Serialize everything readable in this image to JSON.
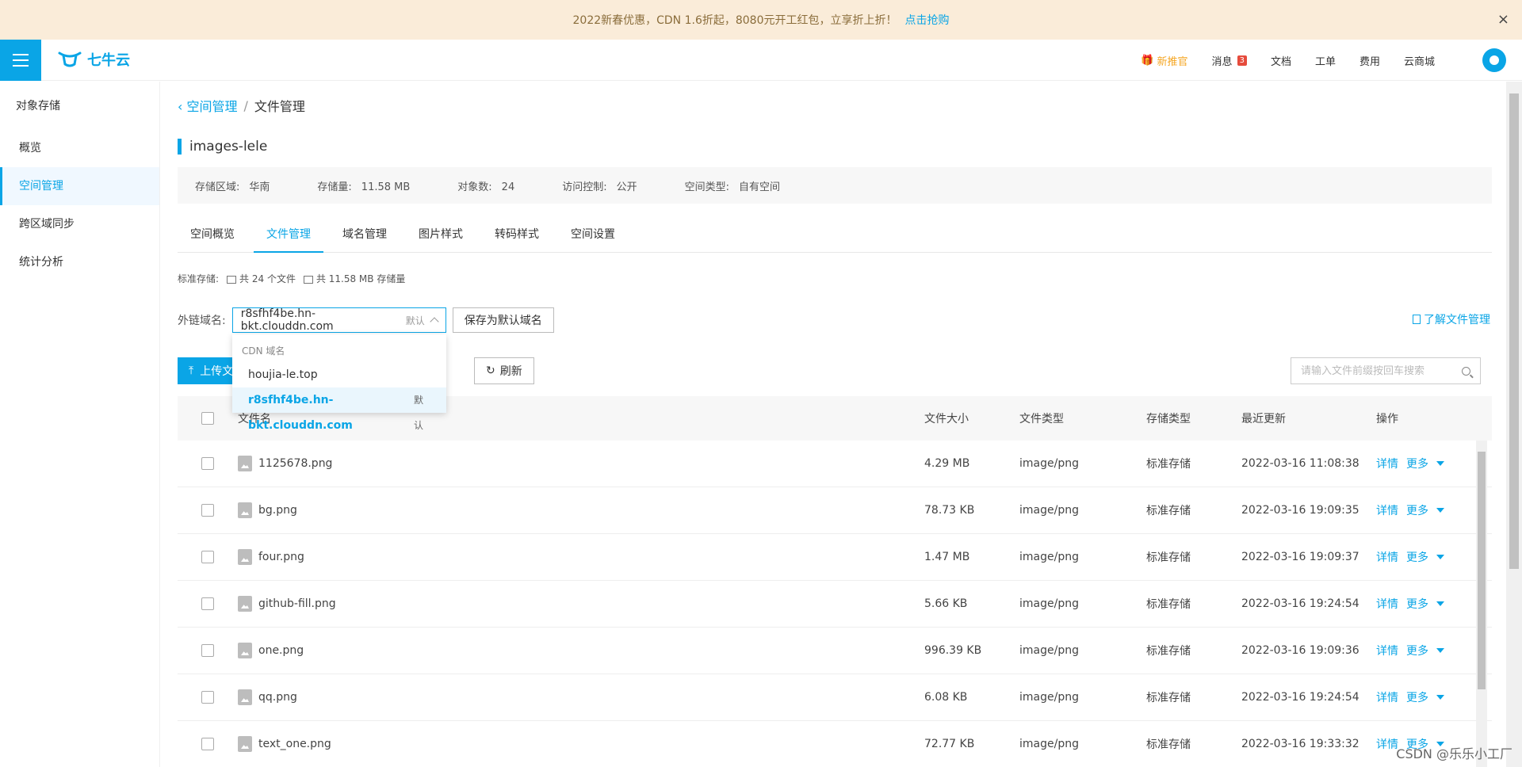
{
  "promo": {
    "text": "2022新春优惠，CDN 1.6折起，8080元开工红包，立享折上折！",
    "link": "点击抢购",
    "close": "×"
  },
  "header": {
    "logo_text": "七牛云",
    "nav": {
      "promo": "新推官",
      "messages": "消息",
      "messages_badge": "3",
      "docs": "文档",
      "tickets": "工单",
      "billing": "费用",
      "marketplace": "云商城"
    }
  },
  "sidebar": {
    "title": "对象存储",
    "items": [
      {
        "label": "概览"
      },
      {
        "label": "空间管理"
      },
      {
        "label": "跨区域同步"
      },
      {
        "label": "统计分析"
      }
    ]
  },
  "breadcrumb": {
    "back": "空间管理",
    "sep": "/",
    "current": "文件管理"
  },
  "bucket": {
    "name": "images-lele",
    "region_label": "存储区域:",
    "region": "华南",
    "size_label": "存储量:",
    "size": "11.58 MB",
    "count_label": "对象数:",
    "count": "24",
    "acl_label": "访问控制:",
    "acl": "公开",
    "type_label": "空间类型:",
    "type": "自有空间"
  },
  "tabs": [
    "空间概览",
    "文件管理",
    "域名管理",
    "图片样式",
    "转码样式",
    "空间设置"
  ],
  "storage": {
    "label": "标准存储:",
    "files": "共 24 个文件",
    "capacity": "共 11.58 MB 存储量"
  },
  "domain": {
    "label": "外链域名:",
    "selected": "r8sfhf4be.hn-bkt.clouddn.com",
    "default_tag": "默认",
    "save_btn": "保存为默认域名",
    "learn_link": "了解文件管理",
    "dropdown": {
      "group": "CDN 域名",
      "options": [
        {
          "label": "houjia-le.top",
          "tag": ""
        },
        {
          "label": "r8sfhf4be.hn-bkt.clouddn.com",
          "tag": "默认"
        }
      ]
    }
  },
  "actions": {
    "upload": "上传文",
    "refresh": "刷新",
    "search_placeholder": "请输入文件前缀按回车搜索"
  },
  "table": {
    "headers": {
      "name": "文件名",
      "size": "文件大小",
      "type": "文件类型",
      "storage": "存储类型",
      "updated": "最近更新",
      "ops": "操作"
    },
    "op_detail": "详情",
    "op_more": "更多",
    "rows": [
      {
        "name": "1125678.png",
        "size": "4.29 MB",
        "type": "image/png",
        "storage": "标准存储",
        "updated": "2022-03-16 11:08:38"
      },
      {
        "name": "bg.png",
        "size": "78.73 KB",
        "type": "image/png",
        "storage": "标准存储",
        "updated": "2022-03-16 19:09:35"
      },
      {
        "name": "four.png",
        "size": "1.47 MB",
        "type": "image/png",
        "storage": "标准存储",
        "updated": "2022-03-16 19:09:37"
      },
      {
        "name": "github-fill.png",
        "size": "5.66 KB",
        "type": "image/png",
        "storage": "标准存储",
        "updated": "2022-03-16 19:24:54"
      },
      {
        "name": "one.png",
        "size": "996.39 KB",
        "type": "image/png",
        "storage": "标准存储",
        "updated": "2022-03-16 19:09:36"
      },
      {
        "name": "qq.png",
        "size": "6.08 KB",
        "type": "image/png",
        "storage": "标准存储",
        "updated": "2022-03-16 19:24:54"
      },
      {
        "name": "text_one.png",
        "size": "72.77 KB",
        "type": "image/png",
        "storage": "标准存储",
        "updated": "2022-03-16 19:33:32"
      }
    ]
  },
  "watermark": "CSDN @乐乐小工厂",
  "colors": {
    "accent": "#0aa5e6",
    "promo_bg": "#faecd9"
  }
}
